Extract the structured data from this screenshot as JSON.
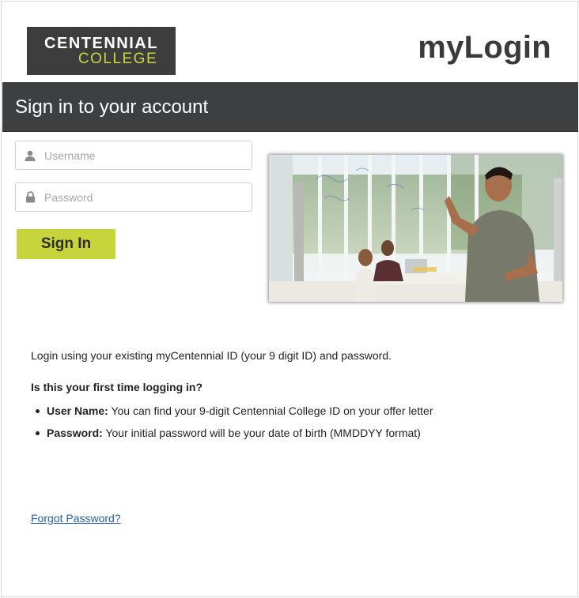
{
  "header": {
    "logo_line1": "CENTENNIAL",
    "logo_line2": "COLLEGE",
    "app_title": "myLogin"
  },
  "banner": {
    "title": "Sign in to your account"
  },
  "form": {
    "username_placeholder": "Username",
    "password_placeholder": "Password",
    "signin_label": "Sign In"
  },
  "info": {
    "intro": "Login using your existing myCentennial ID (your 9 digit ID) and password.",
    "question": "Is this your first time logging in?",
    "bullets": [
      {
        "term": "User Name:",
        "text": " You can find your 9-digit Centennial College ID on your offer letter"
      },
      {
        "term": "Password:",
        "text": " Your initial password will be your date of birth (MMDDYY format)"
      }
    ]
  },
  "links": {
    "forgot": "Forgot Password?"
  },
  "colors": {
    "accent": "#c8d43c",
    "banner": "#3e3f40",
    "logo_bg": "#3d3d3e",
    "link": "#1f5fa8"
  }
}
